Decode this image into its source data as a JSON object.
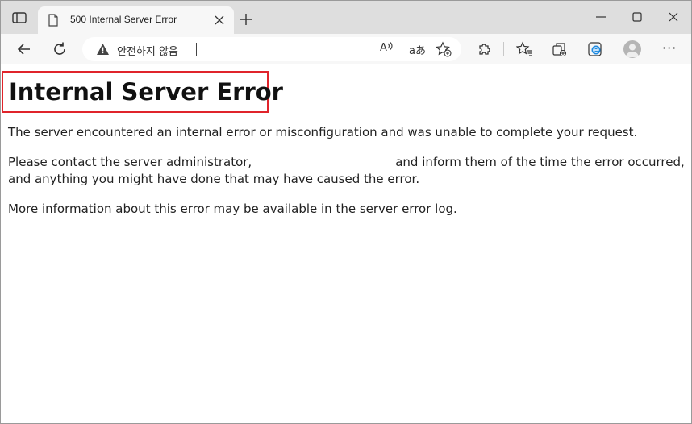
{
  "browser": {
    "tab_title": "500 Internal Server Error",
    "security_warning": "안전하지 않음",
    "read_aloud_label": "A",
    "translate_label": "aあ"
  },
  "page": {
    "title": "Internal Server Error",
    "paragraph1": "The server encountered an internal error or misconfiguration and was unable to complete your request.",
    "paragraph2_part1": "Please contact the server administrator,",
    "paragraph2_part2": "and inform them of the time the error occurred,",
    "paragraph2_line2": "and anything you might have done that may have caused the error.",
    "paragraph3": "More information about this error may be available in the server error log."
  },
  "colors": {
    "highlight_border": "#e0242b",
    "titlebar": "#dedede",
    "toolbar": "#f7f7f7"
  },
  "icons": [
    "tab-actions-icon",
    "page-icon",
    "close-icon",
    "plus-icon",
    "minimize-icon",
    "maximize-icon",
    "back-icon",
    "refresh-icon",
    "warning-icon",
    "read-aloud-icon",
    "translate-icon",
    "favorite-add-icon",
    "extensions-icon",
    "favorites-icon",
    "collections-icon",
    "edge-icon",
    "profile-avatar",
    "more-icon"
  ]
}
